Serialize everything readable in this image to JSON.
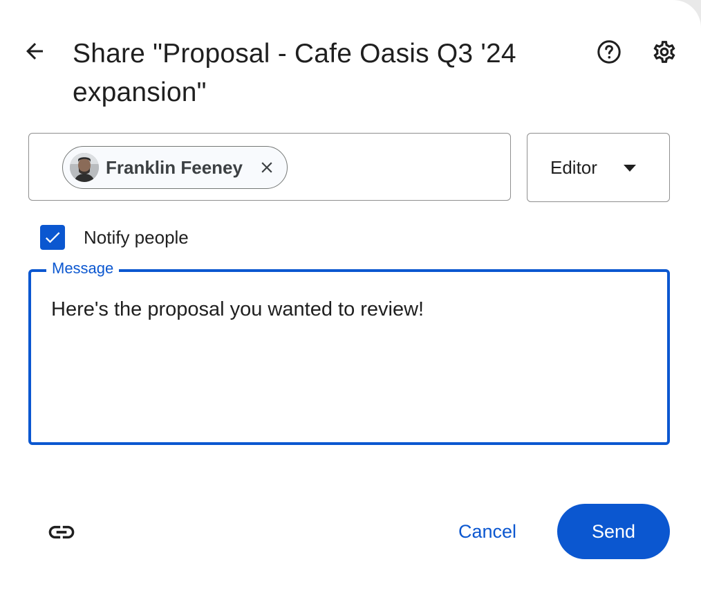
{
  "dialog": {
    "title": "Share \"Proposal - Cafe Oasis Q3 '24 expansion\"",
    "back_icon": "arrow-back-icon",
    "help_icon": "help-icon",
    "settings_icon": "gear-icon"
  },
  "people": {
    "chips": [
      {
        "name": "Franklin Feeney",
        "remove_icon": "close-icon"
      }
    ],
    "role": {
      "selected": "Editor",
      "icon": "caret-down-icon"
    }
  },
  "notify": {
    "label": "Notify people",
    "checked": true
  },
  "message": {
    "label": "Message",
    "value": "Here's the proposal you wanted to review!"
  },
  "footer": {
    "link_icon": "link-icon",
    "cancel_label": "Cancel",
    "send_label": "Send"
  },
  "colors": {
    "accent": "#0b57d0",
    "text": "#1f1f1f",
    "border": "#8e8e8e"
  }
}
